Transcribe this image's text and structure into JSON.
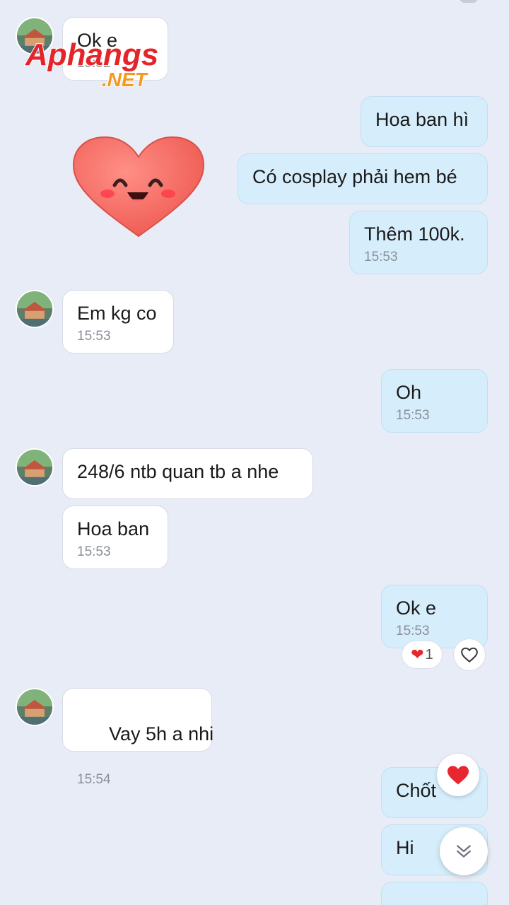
{
  "watermark": {
    "text_main": "Aphangs",
    "text_sub": ".NET"
  },
  "messages": [
    {
      "text": "Ok e",
      "time": "15:52"
    },
    {
      "text": "Hoa ban hì"
    },
    {
      "text": "Có cosplay phải hem bé"
    },
    {
      "text": "Thêm 100k.",
      "time": "15:53"
    },
    {
      "text": "Em kg co",
      "time": "15:53"
    },
    {
      "text": "Oh",
      "time": "15:53"
    },
    {
      "text": "248/6 ntb quan tb a nhe"
    },
    {
      "text": "Hoa ban",
      "time": "15:53"
    },
    {
      "text": "Ok e",
      "time": "15:53"
    },
    {
      "text": "  Vay 5h a nhi",
      "time": "15:54"
    },
    {
      "text": "Chốt"
    },
    {
      "text": "Hi"
    }
  ],
  "reactions": {
    "heart_count": "1"
  },
  "colors": {
    "background": "#e8ecf6",
    "incoming_bubble": "#ffffff",
    "outgoing_bubble": "#d6eefc",
    "heart": "#e8262f",
    "sticker_heart": "#f0675f"
  },
  "icons": [
    "avatar",
    "heart-sticker",
    "heart-icon",
    "heart-outline-icon",
    "double-chevron-down-icon"
  ]
}
